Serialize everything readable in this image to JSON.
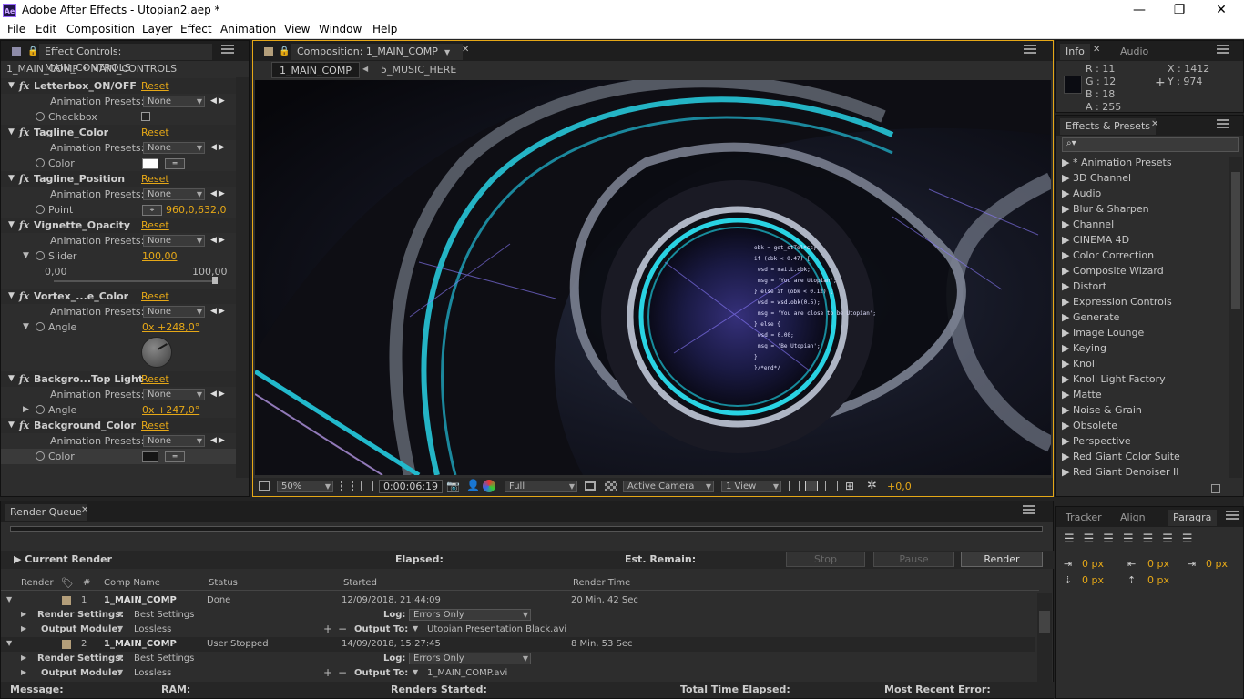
{
  "window": {
    "title": "Adobe After Effects - Utopian2.aep *",
    "app_badge": "Ae",
    "minimize": "—",
    "maximize": "❐",
    "close": "✕"
  },
  "menu": [
    "File",
    "Edit",
    "Composition",
    "Layer",
    "Effect",
    "Animation",
    "View",
    "Window",
    "Help"
  ],
  "effect_controls": {
    "tab": "Effect Controls: MAIN_CONTROLS",
    "breadcrumb": "1_MAIN_COMP • MAIN_CONTROLS",
    "reset": "Reset",
    "anim_presets_label": "Animation Presets:",
    "preset_value": "None",
    "effects": [
      {
        "name": "Letterbox_ON/OFF",
        "prop": "Checkbox"
      },
      {
        "name": "Tagline_Color",
        "prop": "Color"
      },
      {
        "name": "Tagline_Position",
        "prop": "Point",
        "value": "960,0,632,0"
      },
      {
        "name": "Vignette_Opacity",
        "prop": "Slider",
        "value": "100,00",
        "min": "0,00",
        "max": "100,00"
      },
      {
        "name": "Vortex_...e_Color",
        "prop": "Angle",
        "value": "0x +248,0°"
      },
      {
        "name": "Backgro...Top Light",
        "prop": "Angle",
        "value": "0x +247,0°"
      },
      {
        "name": "Background_Color",
        "prop": "Color"
      }
    ]
  },
  "composition": {
    "tab": "Composition: 1_MAIN_COMP",
    "crumbs": [
      "1_MAIN_COMP",
      "5_MUSIC_HERE"
    ],
    "toolbar": {
      "zoom": "50%",
      "timecode": "0:00:06:19",
      "resolution": "Full",
      "camera": "Active Camera",
      "views": "1 View",
      "exposure": "+0,0"
    },
    "overlay_code": [
      "obk = get_stTel*sc;",
      "if (obk < 0.47) {",
      "  wsd = mai.L.obk;",
      "  msg = 'You are Utopian';",
      "} else if (obk < 0.12) {",
      "  wsd = wsd.obk(0.5);",
      "  msg = 'You are close to be Utopian';",
      "} else {",
      "  wsd = 0.00;",
      "  msg = 'Be Utopian';",
      "}",
      "}/*end*/"
    ]
  },
  "info": {
    "tab1": "Info",
    "tab2": "Audio",
    "R": "R : 11",
    "G": "G : 12",
    "B": "B : 18",
    "A": "A : 255",
    "X": "X : 1412",
    "Y": "Y : 974",
    "color": "#0b0c12"
  },
  "effects_presets": {
    "tab": "Effects & Presets",
    "search_placeholder": "",
    "items": [
      "* Animation Presets",
      "3D Channel",
      "Audio",
      "Blur & Sharpen",
      "Channel",
      "CINEMA 4D",
      "Color Correction",
      "Composite Wizard",
      "Distort",
      "Expression Controls",
      "Generate",
      "Image Lounge",
      "Keying",
      "Knoll",
      "Knoll Light Factory",
      "Matte",
      "Noise & Grain",
      "Obsolete",
      "Perspective",
      "Red Giant Color Suite",
      "Red Giant Denoiser II"
    ]
  },
  "paragraph": {
    "tabs": [
      "Tracker",
      "Align",
      "Paragra"
    ],
    "px": "0 px"
  },
  "render_queue": {
    "tab": "Render Queue",
    "current_render": "Current Render",
    "elapsed": "Elapsed:",
    "est_remain": "Est. Remain:",
    "stop": "Stop",
    "pause": "Pause",
    "render": "Render",
    "columns": [
      "Render",
      "#",
      "Comp Name",
      "Status",
      "Started",
      "Render Time"
    ],
    "labels": {
      "render_settings": "Render Settings:",
      "output_module": "Output Module:",
      "log": "Log:",
      "output_to": "Output To:"
    },
    "items": [
      {
        "num": "1",
        "comp": "1_MAIN_COMP",
        "status": "Done",
        "started": "12/09/2018, 21:44:09",
        "time": "20 Min, 42 Sec",
        "settings": "Best Settings",
        "log": "Errors Only",
        "module": "Lossless",
        "output": "Utopian Presentation Black.avi"
      },
      {
        "num": "2",
        "comp": "1_MAIN_COMP",
        "status": "User Stopped",
        "started": "14/09/2018, 15:27:45",
        "time": "8 Min, 53 Sec",
        "settings": "Best Settings",
        "log": "Errors Only",
        "module": "Lossless",
        "output": "1_MAIN_COMP.avi"
      }
    ],
    "footer": {
      "message": "Message:",
      "ram": "RAM:",
      "renders_started": "Renders Started:",
      "total_time": "Total Time Elapsed:",
      "recent_error": "Most Recent Error:"
    }
  }
}
